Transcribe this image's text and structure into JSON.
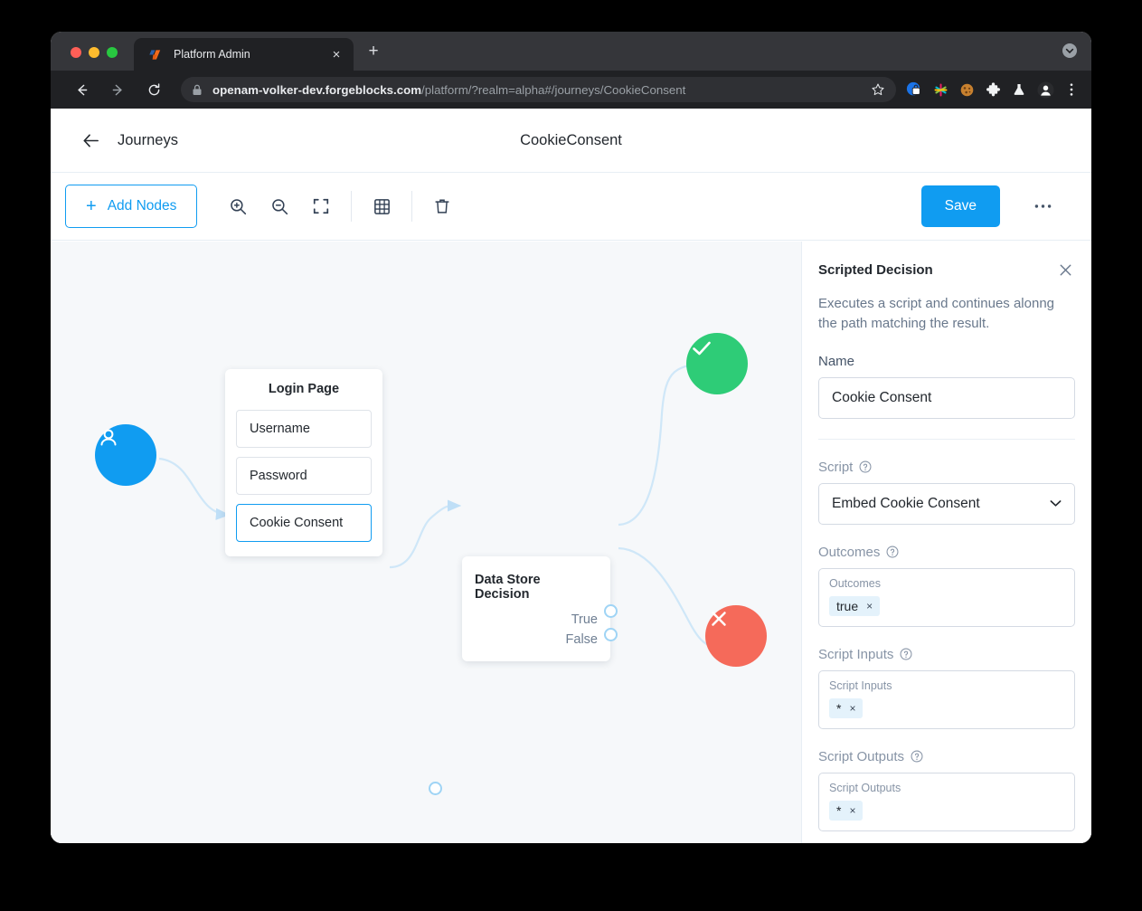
{
  "browser": {
    "tab": {
      "title": "Platform Admin",
      "favicon": "forgerock-logo-icon",
      "close_label": "×"
    },
    "new_tab_label": "+",
    "omnibox": {
      "host": "openam-volker-dev.forgeblocks.com",
      "path": "/platform/?realm=alpha#/journeys/CookieConsent",
      "lock": "lock-icon",
      "star": "bookmark-star-icon"
    },
    "extensions": [
      {
        "name": "password-manager-icon",
        "glyph": "●"
      },
      {
        "name": "colorful-asterisk-icon",
        "glyph": "✸"
      },
      {
        "name": "cookie-icon",
        "glyph": "●"
      },
      {
        "name": "puzzle-piece-icon",
        "glyph": "❖"
      },
      {
        "name": "flask-icon",
        "glyph": "⚗"
      },
      {
        "name": "profile-avatar-icon",
        "glyph": "●"
      },
      {
        "name": "chrome-menu-icon",
        "glyph": "⋮"
      }
    ]
  },
  "header": {
    "back_label": "←",
    "breadcrumb": "Journeys",
    "title": "CookieConsent"
  },
  "toolbar": {
    "add_nodes_label": "Add Nodes",
    "add_nodes_plus": "+",
    "tools": [
      {
        "name": "zoom-in-icon",
        "label": "Zoom In"
      },
      {
        "name": "zoom-out-icon",
        "label": "Zoom Out"
      },
      {
        "name": "fit-screen-icon",
        "label": "Fit to Screen"
      },
      {
        "name": "grid-toggle-icon",
        "label": "Toggle Grid"
      },
      {
        "name": "delete-icon",
        "label": "Delete"
      }
    ],
    "save_label": "Save",
    "more_label": "•••"
  },
  "canvas": {
    "start_node": {
      "name": "start-node",
      "icon": "user-icon"
    },
    "success_node": {
      "name": "success-node",
      "icon": "check-icon"
    },
    "failure_node": {
      "name": "failure-node",
      "icon": "close-icon"
    },
    "login_page_node": {
      "title": "Login Page",
      "children": [
        {
          "label": "Username",
          "selected": false
        },
        {
          "label": "Password",
          "selected": false
        },
        {
          "label": "Cookie Consent",
          "selected": true
        }
      ]
    },
    "data_store_node": {
      "title": "Data Store Decision",
      "outcomes": [
        "True",
        "False"
      ]
    }
  },
  "panel": {
    "title": "Scripted Decision",
    "close_label": "✕",
    "description": "Executes a script and continues alonng the path matching the result.",
    "name_label": "Name",
    "name_value": "Cookie Consent",
    "script_label": "Script",
    "script_value": "Embed Cookie Consent",
    "script_chevron": "⌄",
    "outcomes_label": "Outcomes",
    "outcomes_box_label": "Outcomes",
    "outcomes_tags": [
      {
        "label": "true",
        "remove": "×"
      }
    ],
    "script_inputs_label": "Script Inputs",
    "script_inputs_box_label": "Script Inputs",
    "script_inputs_tags": [
      {
        "label": "*",
        "remove": "×"
      }
    ],
    "script_outputs_label": "Script Outputs",
    "script_outputs_box_label": "Script Outputs",
    "script_outputs_tags": [
      {
        "label": "*",
        "remove": "×"
      }
    ]
  },
  "colors": {
    "accent": "#109cf1",
    "success": "#2ecc77",
    "failure": "#f56a5a",
    "canvas_bg": "#f6f8fa",
    "connector": "#cfe7f8"
  }
}
